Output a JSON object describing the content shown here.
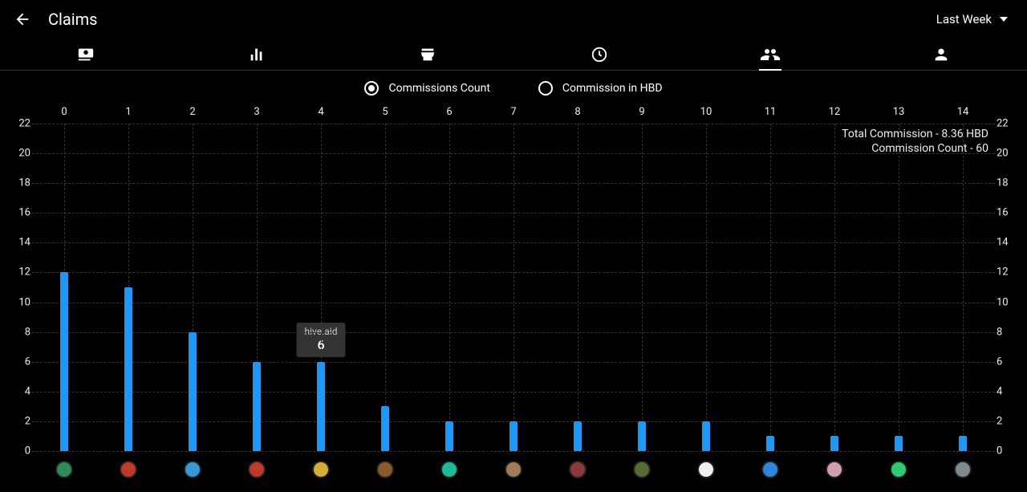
{
  "header": {
    "title": "Claims",
    "range_label": "Last Week"
  },
  "radios": {
    "count_label": "Commissions Count",
    "hbd_label": "Commission in HBD",
    "selected": "count"
  },
  "summary": {
    "line1": "Total Commission - 8.36 HBD",
    "line2": "Commission Count - 60"
  },
  "tooltip": {
    "name": "hive.aid",
    "value": "6",
    "index": 4
  },
  "chart_data": {
    "type": "bar",
    "title": "",
    "xlabel": "",
    "ylabel": "",
    "ylim": [
      0,
      22
    ],
    "yticks": [
      0,
      2,
      4,
      6,
      8,
      10,
      12,
      14,
      16,
      18,
      20,
      22
    ],
    "categories": [
      "0",
      "1",
      "2",
      "3",
      "4",
      "5",
      "6",
      "7",
      "8",
      "9",
      "10",
      "11",
      "12",
      "13",
      "14"
    ],
    "values": [
      12,
      11,
      8,
      6,
      6,
      3,
      2,
      2,
      2,
      2,
      2,
      1,
      1,
      1,
      1
    ],
    "avatar_colors": [
      "#2e8b57",
      "#c0392b",
      "#3498db",
      "#c0392b",
      "#d4af37",
      "#8b5a2b",
      "#1abc9c",
      "#a17c5b",
      "#8b3a3a",
      "#556b2f",
      "#ecf0f1",
      "#2e86de",
      "#d19fb4",
      "#2ecc71",
      "#7f8c8d"
    ]
  }
}
